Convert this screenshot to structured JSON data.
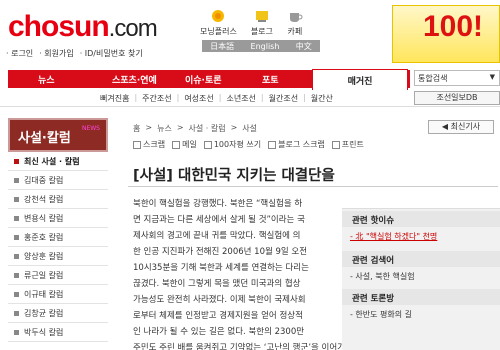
{
  "header": {
    "logo": "chosun",
    "logo_suffix": ".com",
    "top_menu": [
      "· 로그인",
      "· 회원가입",
      "· ID/비밀번호 찾기"
    ],
    "services": [
      {
        "label": "모닝플러스",
        "icon": "morningplus-icon"
      },
      {
        "label": "블로그",
        "icon": "blog-icon"
      },
      {
        "label": "카페",
        "icon": "cafe-icon"
      }
    ],
    "languages": [
      "日本語",
      "English",
      "中文"
    ],
    "ad_text": "100!"
  },
  "nav": {
    "items": [
      "뉴스",
      "스포츠·연예",
      "이슈·토론",
      "포토"
    ],
    "active": "매거진",
    "search_select": "통합검색",
    "sub_items": [
      "뻐겨진홈",
      "주간조선",
      "여성조선",
      "소년조선",
      "월간조선",
      "월간산"
    ],
    "db_button": "조선일보DB"
  },
  "sidebar": {
    "title": "사설·칼럼",
    "badge": "NEWS",
    "items": [
      "최신 사설 · 칼럼",
      "김대중 칼럼",
      "강천석 칼럼",
      "변용식 칼럼",
      "홍준호 칼럼",
      "양상훈 칼럼",
      "류근일 칼럼",
      "이규태 칼럼",
      "김창균 칼럼",
      "박두식 칼럼"
    ]
  },
  "content": {
    "breadcrumb": [
      "홈",
      ">",
      "뉴스",
      ">",
      "사설 · 칼럼",
      ">",
      "사설"
    ],
    "latest_button": "◀ 최신기사",
    "toolbar": [
      "스크랩",
      "메일",
      "100자평 쓰기",
      "블로그 스크랩",
      "프린트"
    ],
    "title": "[사설] 대한민국 지키는 대결단을",
    "body": [
      "북한이 핵실험을 강행했다. 북한은 “핵실험을 하",
      "면 지금과는 다른 세상에서 살게 될 것”이라는 국",
      "제사회의 경고에 끝내 귀를 막았다. 핵실험에 의",
      "한 인공 지진파가 전해진 2006년 10월 9일 오전",
      "10시35분을 기해 북한과 세계를 연결하는 다리는",
      "끊겼다. 북한이 그렇게 목을 맸던 미국과의 협상",
      "가능성도 완전히 사라졌다. 이제 북한이 국제사회",
      "로부터 체제를 인정받고 경제지원을 얻어 정상적",
      "인 나라가 될 수 있는 길은 없다. 북한의 2300만",
      "주민도 주린 배를 움켜쥐고 기약없는 ‘고난의 행군’을 이어가야 한다. 북한 핵핵도박의 결"
    ]
  },
  "related": {
    "h1": "관련 핫이슈",
    "i1": "- 北 \"핵실험 하겠다\" 천명",
    "h2": "관련 검색어",
    "i2": "- 사설, 북한 핵실험",
    "h3": "관련 토론방",
    "i3": "- 한반도 평화의 길"
  },
  "colors": {
    "brand": "#e60012",
    "nav": "#d80c18",
    "sidebar": "#8e2a24"
  }
}
